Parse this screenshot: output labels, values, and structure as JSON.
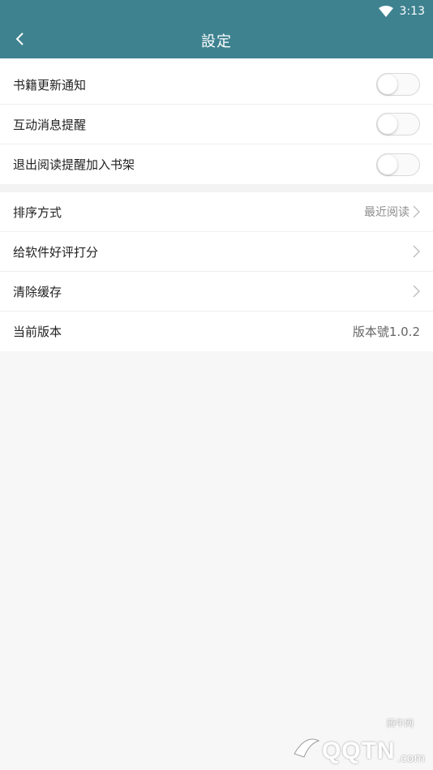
{
  "status_bar": {
    "time": "3:13"
  },
  "app_bar": {
    "title": "設定"
  },
  "toggles": [
    {
      "label": "书籍更新通知",
      "on": false
    },
    {
      "label": "互动消息提醒",
      "on": false
    },
    {
      "label": "退出阅读提醒加入书架",
      "on": false
    }
  ],
  "menu": {
    "sort": {
      "label": "排序方式",
      "value": "最近阅读"
    },
    "rate": {
      "label": "给软件好评打分"
    },
    "clear_cache": {
      "label": "清除缓存"
    },
    "version": {
      "label": "当前版本",
      "value": "版本號1.0.2"
    }
  },
  "watermark": {
    "small": "腾牛网",
    "main": "QQTN",
    "suffix": ".com"
  },
  "colors": {
    "header": "#3e8290",
    "background": "#f7f7f7"
  }
}
